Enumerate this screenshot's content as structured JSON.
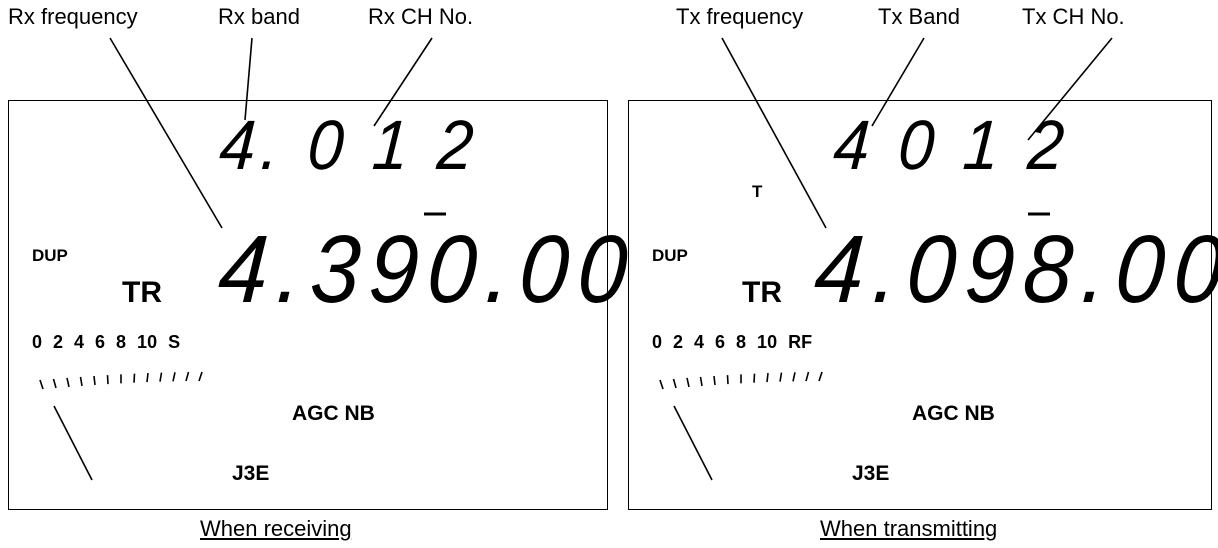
{
  "receive": {
    "callouts": {
      "freq": "Rx frequency",
      "band": "Rx band",
      "ch": "Rx CH No."
    },
    "dup": "DUP",
    "tr": "TR",
    "channel_display": "4. 0 1 2",
    "frequency_display": "4.390.00",
    "scale": "0 2 4 6 8 10 S",
    "agc_nb": "AGC NB",
    "mode": "J3E",
    "caption": "When receiving"
  },
  "transmit": {
    "callouts": {
      "freq": "Tx frequency",
      "band": "Tx Band",
      "ch": "Tx CH No."
    },
    "t": "T",
    "dup": "DUP",
    "tr": "TR",
    "channel_display": "4 0 1 2",
    "frequency_display": "4.098.00",
    "scale": "0 2 4 6 8 10 RF",
    "agc_nb": "AGC NB",
    "mode": "J3E",
    "caption": "When transmitting"
  }
}
